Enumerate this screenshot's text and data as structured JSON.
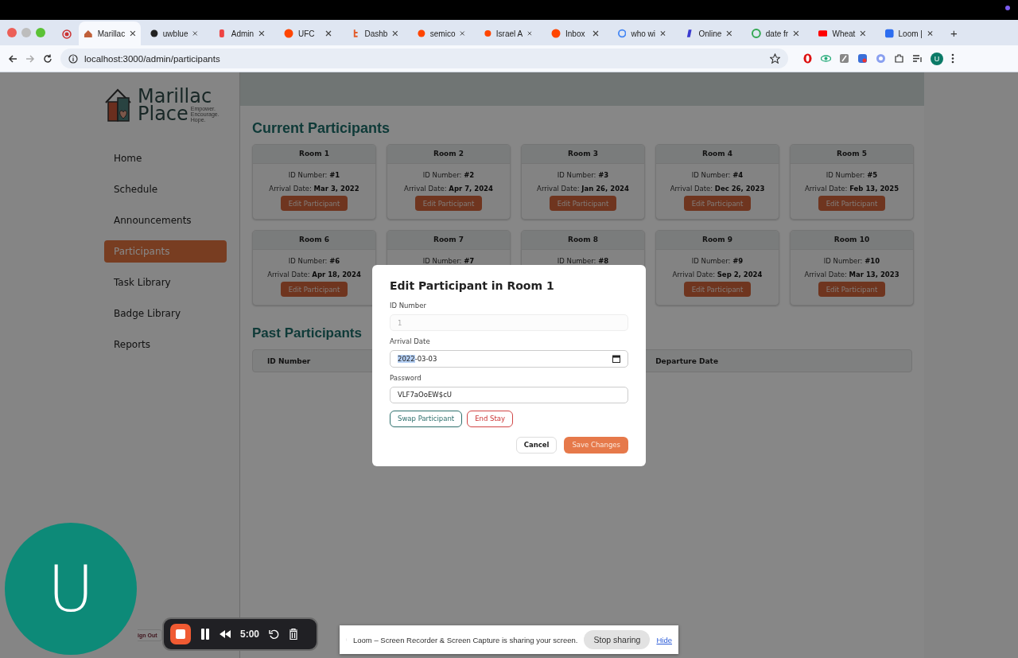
{
  "browser": {
    "tabs": [
      {
        "label": "Marillac",
        "selected": true
      },
      {
        "label": "uwblue",
        "selected": false
      },
      {
        "label": "Admin",
        "selected": false
      },
      {
        "label": "UFC",
        "selected": false
      },
      {
        "label": "Dashb",
        "selected": false
      },
      {
        "label": "semico",
        "selected": false
      },
      {
        "label": "Israel A",
        "selected": false
      },
      {
        "label": "Inbox",
        "selected": false
      },
      {
        "label": "who wi",
        "selected": false
      },
      {
        "label": "Online",
        "selected": false
      },
      {
        "label": "date fr",
        "selected": false
      },
      {
        "label": "Wheat",
        "selected": false
      },
      {
        "label": "Loom |",
        "selected": false
      }
    ],
    "new_tab": "+",
    "address": "localhost:3000/admin/participants",
    "profile": "U"
  },
  "sidebar": {
    "logo": {
      "line_1": "Marillac",
      "line_2": "Place",
      "tagline": "Empower. Encourage. Hope."
    },
    "items": [
      {
        "label": "Home",
        "selected": false
      },
      {
        "label": "Schedule",
        "selected": false
      },
      {
        "label": "Announcements",
        "selected": false
      },
      {
        "label": "Participants",
        "selected": true
      },
      {
        "label": "Task Library",
        "selected": false
      },
      {
        "label": "Badge Library",
        "selected": false
      },
      {
        "label": "Reports",
        "selected": false
      }
    ],
    "sign_out": "ign Out"
  },
  "current_participants": {
    "title": "Current Participants",
    "rooms": [
      {
        "name": "Room 1",
        "id_label": "ID Number:",
        "id": "#1",
        "arrival_label": "Arrival Date:",
        "arrival": "Mar 3, 2022",
        "button": "Edit Participant"
      },
      {
        "name": "Room 2",
        "id_label": "ID Number:",
        "id": "#2",
        "arrival_label": "Arrival Date:",
        "arrival": "Apr 7, 2024",
        "button": "Edit Participant"
      },
      {
        "name": "Room 3",
        "id_label": "ID Number:",
        "id": "#3",
        "arrival_label": "Arrival Date:",
        "arrival": "Jan 26, 2024",
        "button": "Edit Participant"
      },
      {
        "name": "Room 4",
        "id_label": "ID Number:",
        "id": "#4",
        "arrival_label": "Arrival Date:",
        "arrival": "Dec 26, 2023",
        "button": "Edit Participant"
      },
      {
        "name": "Room 5",
        "id_label": "ID Number:",
        "id": "#5",
        "arrival_label": "Arrival Date:",
        "arrival": "Feb 13, 2025",
        "button": "Edit Participant"
      },
      {
        "name": "Room 6",
        "id_label": "ID Number:",
        "id": "#6",
        "arrival_label": "Arrival Date:",
        "arrival": "Apr 18, 2024",
        "button": "Edit Participant"
      },
      {
        "name": "Room 7",
        "id_label": "ID Number:",
        "id": "#7"
      },
      {
        "name": "Room 8",
        "id_label": "ID Number:",
        "id": "#8"
      },
      {
        "name": "Room 9",
        "id_label": "ID Number:",
        "id": "#9",
        "arrival_label": "Arrival Date:",
        "arrival": "Sep 2, 2024",
        "button": "Edit Participant"
      },
      {
        "name": "Room 10",
        "id_label": "ID Number:",
        "id": "#10",
        "arrival_label": "Arrival Date:",
        "arrival": "Mar 13, 2023",
        "button": "Edit Participant"
      }
    ]
  },
  "past_participants": {
    "title": "Past Participants",
    "columns": [
      "ID Number",
      "Departure Date"
    ]
  },
  "modal": {
    "title": "Edit Participant in Room 1",
    "fields": [
      {
        "kind": "text",
        "label": "ID Number",
        "value": "1",
        "disabled": true
      },
      {
        "kind": "date",
        "label": "Arrival Date",
        "value_parts": [
          {
            "text": "2022",
            "selected": true
          },
          {
            "text": "-03-03",
            "selected": false
          }
        ]
      },
      {
        "kind": "text",
        "label": "Password",
        "value": "VLF7aOoEW$cU",
        "disabled": false
      }
    ],
    "actions": [
      {
        "kind": "outline-teal",
        "label": "Swap Participant"
      },
      {
        "kind": "outline-red",
        "label": "End Stay"
      }
    ],
    "footer": [
      {
        "kind": "plain",
        "label": "Cancel"
      },
      {
        "kind": "primary",
        "label": "Save Changes"
      }
    ]
  },
  "recorder": {
    "avatar": "U",
    "timer": "5:00"
  },
  "share_banner": {
    "message": "Loom – Screen Recorder & Screen Capture is sharing your screen.",
    "stop": "Stop sharing",
    "hide": "Hide"
  }
}
